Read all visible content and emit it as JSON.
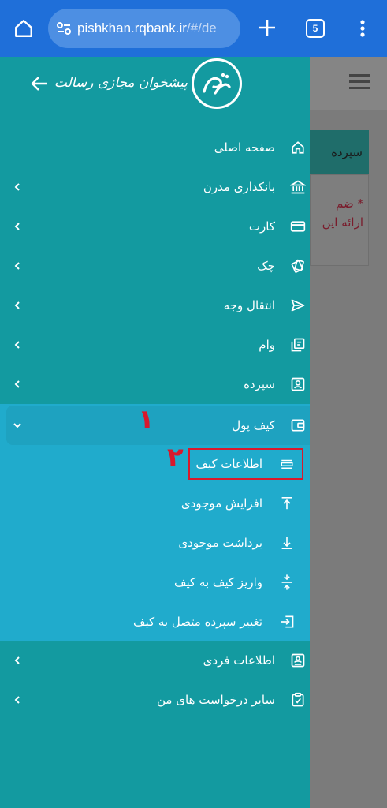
{
  "browser": {
    "url_host": "pishkhan.rqbank.ir",
    "url_path": "/#/de",
    "tab_count": "5"
  },
  "background_page": {
    "card_title": "سپرده",
    "note_line1": "* ضم",
    "note_line2": "ارائه این"
  },
  "drawer": {
    "logo_text": "پیشخوان مجازی رسالت",
    "menu": [
      {
        "label": "صفحه اصلی",
        "icon": "home-icon",
        "has_chevron": false
      },
      {
        "label": "بانکداری مدرن",
        "icon": "bank-icon",
        "has_chevron": true
      },
      {
        "label": "کارت",
        "icon": "card-icon",
        "has_chevron": true
      },
      {
        "label": "چک",
        "icon": "cheque-icon",
        "has_chevron": true
      },
      {
        "label": "انتقال وجه",
        "icon": "send-icon",
        "has_chevron": true
      },
      {
        "label": "وام",
        "icon": "loan-icon",
        "has_chevron": true
      },
      {
        "label": "سپرده",
        "icon": "deposit-icon",
        "has_chevron": true
      },
      {
        "label": "کیف پول",
        "icon": "wallet-icon",
        "has_chevron": true,
        "expanded": true
      }
    ],
    "wallet_submenu": [
      {
        "label": "اطلاعات کیف",
        "icon": "list-icon"
      },
      {
        "label": "افزایش موجودی",
        "icon": "upload-icon"
      },
      {
        "label": "برداشت موجودی",
        "icon": "download-icon"
      },
      {
        "label": "واریز کیف به کیف",
        "icon": "transfer-icon"
      },
      {
        "label": "تغییر سپرده متصل به کیف",
        "icon": "login-icon"
      }
    ],
    "menu_bottom": [
      {
        "label": "اطلاعات فردی",
        "icon": "id-card-icon",
        "has_chevron": true
      },
      {
        "label": "سایر درخواست های من",
        "icon": "checklist-icon",
        "has_chevron": true
      }
    ]
  },
  "annotations": {
    "step1": "۱",
    "step2": "۲",
    "color": "#d8192c"
  },
  "colors": {
    "drawer_bg": "#139aa0",
    "wallet_bg": "#20abcc",
    "browser_bar": "#1f6fd9"
  }
}
